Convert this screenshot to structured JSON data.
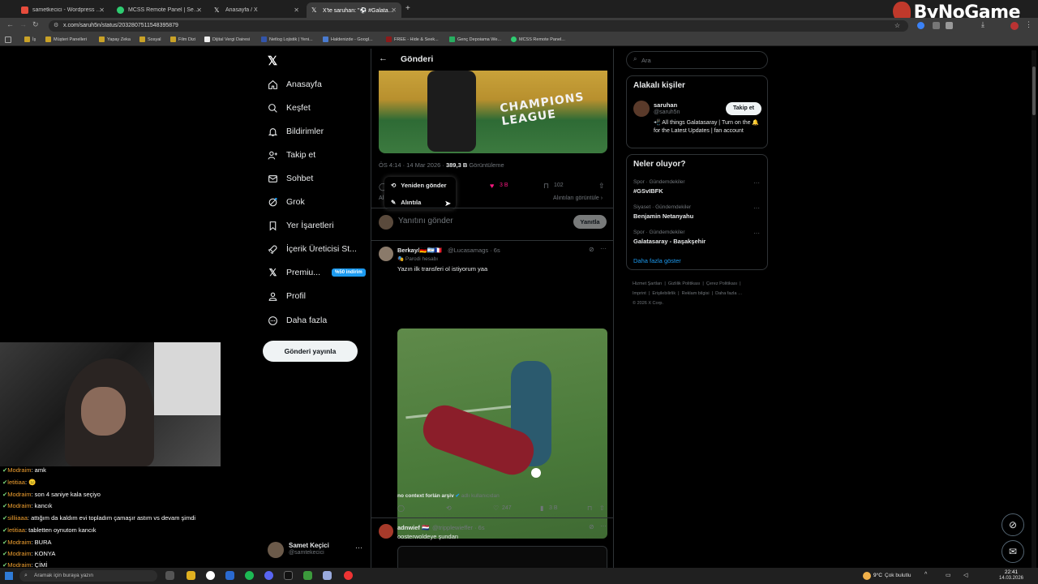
{
  "browser": {
    "tabs": [
      {
        "label": "sametkecici - Wordpress Uzman...",
        "color": "#e74c3c"
      },
      {
        "label": "MCSS Remote Panel | Servers",
        "color": "#2ecc71"
      },
      {
        "label": "Anasayfa / X",
        "color": "#e7e9ea"
      },
      {
        "label": "X'te saruhan: \"⚽ #Galatasa...",
        "color": "#e7e9ea"
      }
    ],
    "url": "x.com/saruh5n/status/2032807511548395879",
    "bookmarks": [
      "İş",
      "Müşteri Panelleri",
      "Yapay Zeka",
      "Sosyal",
      "Film Dizi",
      "Dijital Vergi Dairesi",
      "Netlog Lojistik | Yeni...",
      "Haldenizde - Googl...",
      "FREE - Hide & Seek...",
      "Genç Depoiama We...",
      "MCSS Remote Panel..."
    ],
    "brand": "ByNoGame"
  },
  "nav": {
    "items": [
      {
        "label": "Anasayfa",
        "icon": "home-icon"
      },
      {
        "label": "Keşfet",
        "icon": "search-icon"
      },
      {
        "label": "Bildirimler",
        "icon": "bell-icon"
      },
      {
        "label": "Takip et",
        "icon": "follow-icon"
      },
      {
        "label": "Sohbet",
        "icon": "mail-icon"
      },
      {
        "label": "Grok",
        "icon": "grok-icon"
      },
      {
        "label": "Yer İşaretleri",
        "icon": "bookmark-icon"
      },
      {
        "label": "İçerik Üreticisi St...",
        "icon": "rocket-icon"
      },
      {
        "label": "Premiu...",
        "icon": "x-icon"
      },
      {
        "label": "Profil",
        "icon": "person-icon"
      },
      {
        "label": "Daha fazla",
        "icon": "more-circle-icon"
      }
    ],
    "premium_badge": "%50 indirim",
    "post_button": "Gönderi yayınla",
    "account": {
      "name": "Samet Keçici",
      "handle": "@samtekecici"
    }
  },
  "main": {
    "header": "Gönderi",
    "meta_time": "ÖS 4:14 · 14 Mar 2026 ·",
    "views": "389,3 B",
    "views_label": "Görüntüleme",
    "likes": "3 B",
    "bookmarks": "102",
    "menu": {
      "repost": "Yeniden gönder",
      "quote": "Alıntıla"
    },
    "quotes_link": "Alıntıları görüntüle",
    "quotes_short": "Al",
    "reply_placeholder": "Yanıtını gönder",
    "reply_button": "Yanıtla",
    "media_text": "CHAMPIONS LEAGUE",
    "reply1": {
      "name": "Berkay/🇩🇪🇦🇷🇫🇷",
      "handle": "@Lucasamags · 6s",
      "badge": "Parodi hesabı",
      "text": "Yazın ilk transferi ol istiyorum yaa",
      "credit": "no context forlán arşiv",
      "credit_suffix": "adlı kullanıcıdan",
      "stats": {
        "reposts": "",
        "likes": "247",
        "views": "3 B"
      }
    },
    "reply2": {
      "name": "adnwief 🇳🇱",
      "handle": "@tripplewieffer · 6s",
      "text": "oosterwoldeye şundan"
    }
  },
  "right": {
    "search_placeholder": "Ara",
    "related_title": "Alakalı kişiler",
    "person": {
      "name": "saruhan",
      "handle": "@saruh5n",
      "bio": "📲 All things Galatasaray | Turn on the 🔔 for the Latest Updates | fan account",
      "follow": "Takip et"
    },
    "trends_title": "Neler oluyor?",
    "trends": [
      {
        "context": "Spor · Gündemdekiler",
        "name": "#GSvIBFK"
      },
      {
        "context": "Siyaset · Gündemdekiler",
        "name": "Benjamin Netanyahu"
      },
      {
        "context": "Spor · Gündemdekiler",
        "name": "Galatasaray - Başakşehir"
      }
    ],
    "show_more": "Daha fazla göster",
    "footer": [
      "Hizmet Şartları",
      "Gizlilik Politikası",
      "Çerez Politikası",
      "Imprint",
      "Erişilebilirlik",
      "Reklam bilgisi",
      "Daha fazla …",
      "© 2026 X Corp."
    ]
  },
  "chat": [
    {
      "user": "Modraim",
      "msg": "amk"
    },
    {
      "user": "letitiaa",
      "msg": "😐"
    },
    {
      "user": "Modraim",
      "msg": "son 4 saniye kala seçiyo"
    },
    {
      "user": "Modraim",
      "msg": "kancık"
    },
    {
      "user": "silliiaaa",
      "msg": "attığım da kaldım evi topladım çamaşır astım vs devam şimdi"
    },
    {
      "user": "letitiaa",
      "msg": "tabletten oynutom kancık"
    },
    {
      "user": "Modraim",
      "msg": "BURA"
    },
    {
      "user": "Modraim",
      "msg": "KONYA"
    },
    {
      "user": "Modraim",
      "msg": "ÇİMİ"
    }
  ],
  "taskbar": {
    "search": "Aramak için buraya yazın",
    "weather": "9°C",
    "weather_text": "Çok bulutlu",
    "time": "22:41",
    "date": "14.03.2026"
  },
  "colors": {
    "accent": "#1d9bf0",
    "like": "#f91880",
    "premium": "#1d9bf0"
  }
}
